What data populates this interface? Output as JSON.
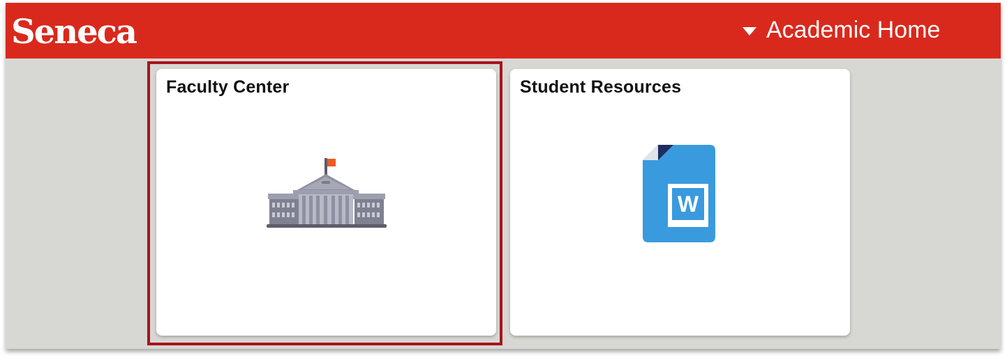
{
  "header": {
    "logo_text": "Seneca",
    "nav_title": "Academic Home",
    "nav_icon": "caret-down-icon",
    "color": "#d9291c"
  },
  "tiles": [
    {
      "title": "Faculty Center",
      "icon": "university-building-icon",
      "selected": true,
      "highlight_color": "#a8141c"
    },
    {
      "title": "Student Resources",
      "icon": "word-document-icon",
      "selected": false,
      "icon_color": "#3a9ade"
    }
  ],
  "colors": {
    "background": "#d7d7d4",
    "tile": "#ffffff"
  }
}
